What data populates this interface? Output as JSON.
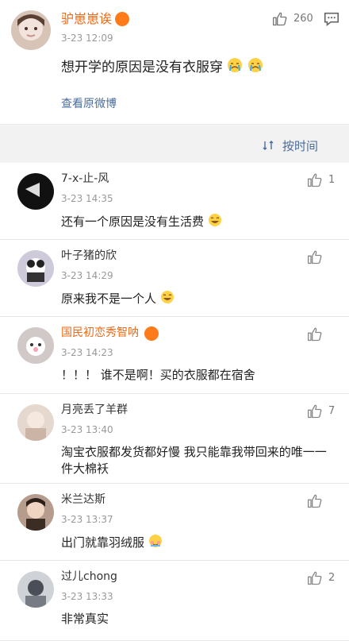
{
  "post": {
    "author": "驴崽崽诶",
    "time": "3-23 12:09",
    "like_count": "260",
    "text": "想开学的原因是没有衣服穿",
    "view_original": "查看原微博"
  },
  "sort": {
    "label": "按时间"
  },
  "comments": [
    {
      "author": "7-x-止-风",
      "time": "3-23 14:35",
      "like_count": "1",
      "text": "还有一个原因是没有生活费"
    },
    {
      "author": "叶子猪的欣",
      "time": "3-23 14:29",
      "like_count": "",
      "text": "原来我不是一个人"
    },
    {
      "author": "国民初恋秀智呐",
      "time": "3-23 14:23",
      "like_count": "",
      "text": "！！！ 谁不是啊！买的衣服都在宿舍"
    },
    {
      "author": "月亮丢了羊群",
      "time": "3-23 13:40",
      "like_count": "7",
      "text": "淘宝衣服都发货都好慢 我只能靠我带回来的唯一一件大棉袄"
    },
    {
      "author": "米兰达斯",
      "time": "3-23 13:37",
      "like_count": "",
      "text": "出门就靠羽绒服"
    },
    {
      "author": "过儿chong",
      "time": "3-23 13:33",
      "like_count": "2",
      "text": "非常真实"
    }
  ],
  "colors": {
    "name_orange": "#ef6a17",
    "link_blue": "#4a6d9d"
  },
  "icons": {
    "like": "thumbs-up-icon",
    "comment": "comment-bubble-icon",
    "sort": "sort-icon",
    "emoji_cry": "crying-emoji-icon",
    "emoji_laugh": "laugh-emoji-icon",
    "emoji_shy": "shy-emoji-icon"
  }
}
